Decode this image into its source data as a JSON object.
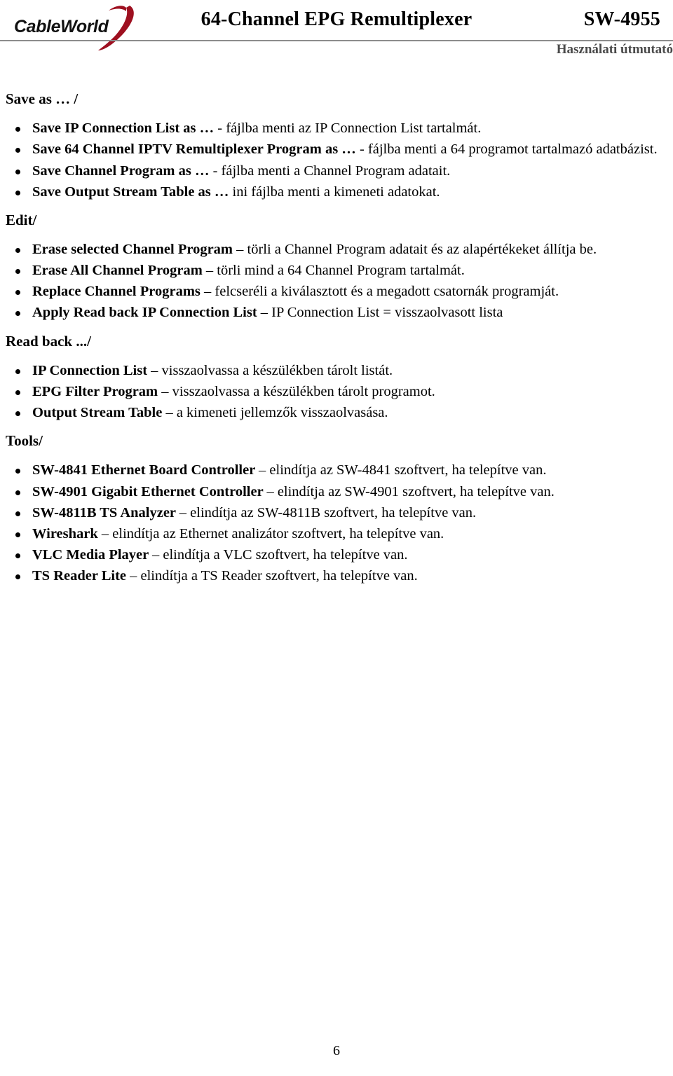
{
  "header": {
    "logo_text": "CableWorld",
    "title": "64-Channel EPG  Remultiplexer",
    "model": "SW-4955",
    "subtitle": "Használati útmutató",
    "swoosh_color": "#9e1020",
    "rule_color": "#8c8c8c",
    "subtitle_color": "#4a4a4a"
  },
  "sections": [
    {
      "heading": "Save as … /",
      "items": [
        {
          "term": "Save IP Connection List as … ",
          "desc": "- fájlba menti az IP Connection List tartalmát.",
          "justify": false
        },
        {
          "term": "Save 64 Channel IPTV Remultiplexer Program as … ",
          "desc": "- fájlba menti a 64 programot tartalmazó adatbázist.",
          "justify": true
        },
        {
          "term": "Save Channel Program as … ",
          "desc": "- fájlba menti a Channel Program adatait.",
          "justify": false
        },
        {
          "term": "Save Output Stream Table as … ",
          "desc": "ini fájlba menti a kimeneti adatokat.",
          "justify": false
        }
      ]
    },
    {
      "heading": "Edit/",
      "items": [
        {
          "term": "Erase selected Channel Program ",
          "desc": "– törli a Channel Program adatait és az alapértékeket állítja be.",
          "justify": true
        },
        {
          "term": "Erase All Channel Program ",
          "desc": "– törli mind a 64 Channel Program tartalmát.",
          "justify": false
        },
        {
          "term": "Replace Channel Programs ",
          "desc": "– felcseréli a kiválasztott és a megadott csatornák programját.",
          "justify": true
        },
        {
          "term": "Apply Read back IP Connection List ",
          "desc": "– IP Connection List = visszaolvasott lista",
          "justify": false
        }
      ]
    },
    {
      "heading": "Read back .../",
      "items": [
        {
          "term": "IP Connection List ",
          "desc": "– visszaolvassa a készülékben tárolt listát.",
          "justify": false
        },
        {
          "term": "EPG Filter Program ",
          "desc": "– visszaolvassa a készülékben tárolt programot.",
          "justify": false
        },
        {
          "term": "Output Stream Table ",
          "desc": "– a kimeneti jellemzők visszaolvasása.",
          "justify": false
        }
      ]
    },
    {
      "heading": "Tools/",
      "items": [
        {
          "term": "SW-4841 Ethernet Board Controller ",
          "desc": "– elindítja az SW-4841 szoftvert, ha telepítve van.",
          "justify": false
        },
        {
          "term": "SW-4901 Gigabit Ethernet Controller ",
          "desc": "– elindítja az SW-4901 szoftvert, ha telepítve van.",
          "justify": false
        },
        {
          "term": "SW-4811B TS Analyzer ",
          "desc": "– elindítja az SW-4811B szoftvert, ha telepítve van.",
          "justify": false
        },
        {
          "term": "Wireshark ",
          "desc": "– elindítja az Ethernet analizátor szoftvert, ha telepítve van.",
          "justify": false
        },
        {
          "term": "VLC Media Player ",
          "desc": "– elindítja a VLC szoftvert, ha telepítve van.",
          "justify": false
        },
        {
          "term": "TS Reader Lite ",
          "desc": "– elindítja a TS Reader szoftvert, ha telepítve van.",
          "justify": false
        }
      ]
    }
  ],
  "footer": {
    "page_number": "6"
  }
}
